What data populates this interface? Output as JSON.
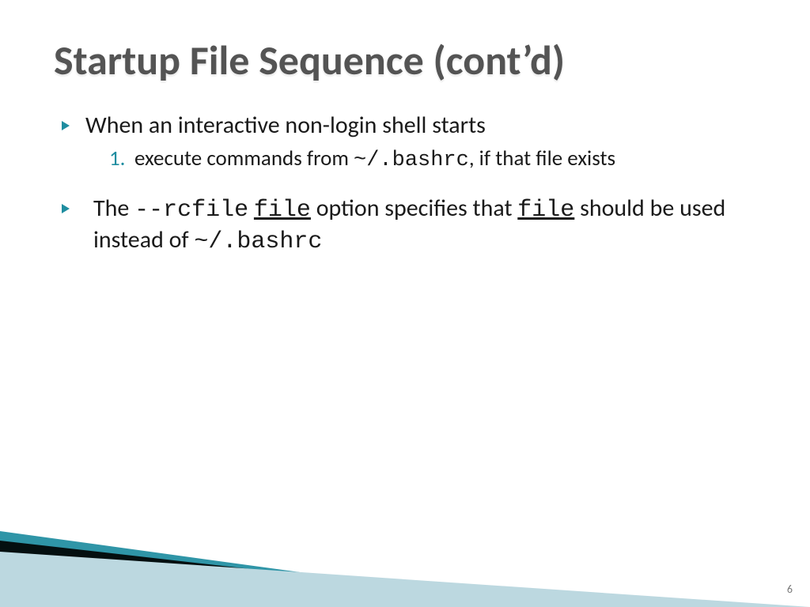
{
  "title": "Startup File Sequence (cont’d)",
  "bullets": {
    "b1": {
      "text": "When an interactive non-login shell starts"
    },
    "b1_sub": {
      "num": "1.",
      "pre": "execute  commands  from ",
      "code": "~/.bashrc",
      "post": ", if that file exists"
    },
    "b2": {
      "pre": " The ",
      "flag": "--rcfile",
      "file1": "file",
      "mid": "  option specifies that ",
      "file2": "file",
      "mid2": " should be used instead of ",
      "code": "~/.bashrc"
    }
  },
  "page": "6"
}
